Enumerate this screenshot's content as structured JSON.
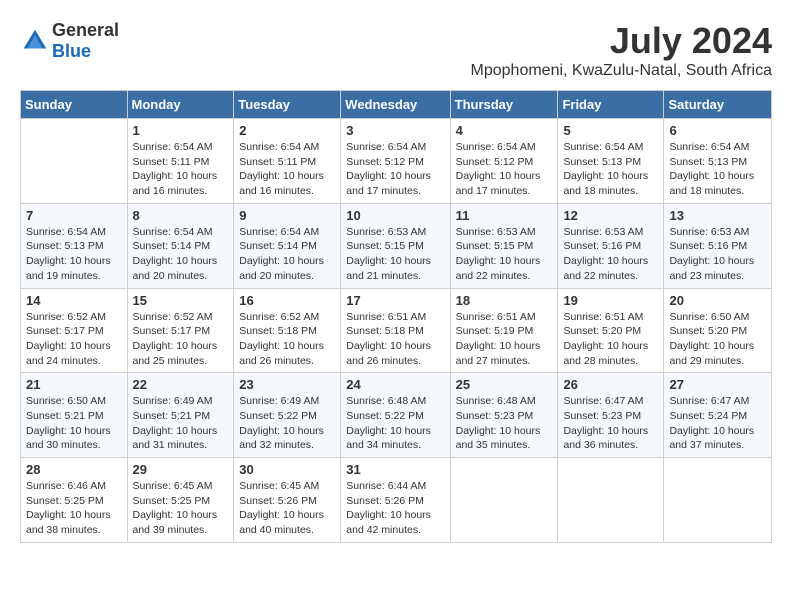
{
  "header": {
    "logo_general": "General",
    "logo_blue": "Blue",
    "month": "July 2024",
    "location": "Mpophomeni, KwaZulu-Natal, South Africa"
  },
  "weekdays": [
    "Sunday",
    "Monday",
    "Tuesday",
    "Wednesday",
    "Thursday",
    "Friday",
    "Saturday"
  ],
  "weeks": [
    [
      {
        "day": "",
        "sunrise": "",
        "sunset": "",
        "daylight": ""
      },
      {
        "day": "1",
        "sunrise": "Sunrise: 6:54 AM",
        "sunset": "Sunset: 5:11 PM",
        "daylight": "Daylight: 10 hours and 16 minutes."
      },
      {
        "day": "2",
        "sunrise": "Sunrise: 6:54 AM",
        "sunset": "Sunset: 5:11 PM",
        "daylight": "Daylight: 10 hours and 16 minutes."
      },
      {
        "day": "3",
        "sunrise": "Sunrise: 6:54 AM",
        "sunset": "Sunset: 5:12 PM",
        "daylight": "Daylight: 10 hours and 17 minutes."
      },
      {
        "day": "4",
        "sunrise": "Sunrise: 6:54 AM",
        "sunset": "Sunset: 5:12 PM",
        "daylight": "Daylight: 10 hours and 17 minutes."
      },
      {
        "day": "5",
        "sunrise": "Sunrise: 6:54 AM",
        "sunset": "Sunset: 5:13 PM",
        "daylight": "Daylight: 10 hours and 18 minutes."
      },
      {
        "day": "6",
        "sunrise": "Sunrise: 6:54 AM",
        "sunset": "Sunset: 5:13 PM",
        "daylight": "Daylight: 10 hours and 18 minutes."
      }
    ],
    [
      {
        "day": "7",
        "sunrise": "Sunrise: 6:54 AM",
        "sunset": "Sunset: 5:13 PM",
        "daylight": "Daylight: 10 hours and 19 minutes."
      },
      {
        "day": "8",
        "sunrise": "Sunrise: 6:54 AM",
        "sunset": "Sunset: 5:14 PM",
        "daylight": "Daylight: 10 hours and 20 minutes."
      },
      {
        "day": "9",
        "sunrise": "Sunrise: 6:54 AM",
        "sunset": "Sunset: 5:14 PM",
        "daylight": "Daylight: 10 hours and 20 minutes."
      },
      {
        "day": "10",
        "sunrise": "Sunrise: 6:53 AM",
        "sunset": "Sunset: 5:15 PM",
        "daylight": "Daylight: 10 hours and 21 minutes."
      },
      {
        "day": "11",
        "sunrise": "Sunrise: 6:53 AM",
        "sunset": "Sunset: 5:15 PM",
        "daylight": "Daylight: 10 hours and 22 minutes."
      },
      {
        "day": "12",
        "sunrise": "Sunrise: 6:53 AM",
        "sunset": "Sunset: 5:16 PM",
        "daylight": "Daylight: 10 hours and 22 minutes."
      },
      {
        "day": "13",
        "sunrise": "Sunrise: 6:53 AM",
        "sunset": "Sunset: 5:16 PM",
        "daylight": "Daylight: 10 hours and 23 minutes."
      }
    ],
    [
      {
        "day": "14",
        "sunrise": "Sunrise: 6:52 AM",
        "sunset": "Sunset: 5:17 PM",
        "daylight": "Daylight: 10 hours and 24 minutes."
      },
      {
        "day": "15",
        "sunrise": "Sunrise: 6:52 AM",
        "sunset": "Sunset: 5:17 PM",
        "daylight": "Daylight: 10 hours and 25 minutes."
      },
      {
        "day": "16",
        "sunrise": "Sunrise: 6:52 AM",
        "sunset": "Sunset: 5:18 PM",
        "daylight": "Daylight: 10 hours and 26 minutes."
      },
      {
        "day": "17",
        "sunrise": "Sunrise: 6:51 AM",
        "sunset": "Sunset: 5:18 PM",
        "daylight": "Daylight: 10 hours and 26 minutes."
      },
      {
        "day": "18",
        "sunrise": "Sunrise: 6:51 AM",
        "sunset": "Sunset: 5:19 PM",
        "daylight": "Daylight: 10 hours and 27 minutes."
      },
      {
        "day": "19",
        "sunrise": "Sunrise: 6:51 AM",
        "sunset": "Sunset: 5:20 PM",
        "daylight": "Daylight: 10 hours and 28 minutes."
      },
      {
        "day": "20",
        "sunrise": "Sunrise: 6:50 AM",
        "sunset": "Sunset: 5:20 PM",
        "daylight": "Daylight: 10 hours and 29 minutes."
      }
    ],
    [
      {
        "day": "21",
        "sunrise": "Sunrise: 6:50 AM",
        "sunset": "Sunset: 5:21 PM",
        "daylight": "Daylight: 10 hours and 30 minutes."
      },
      {
        "day": "22",
        "sunrise": "Sunrise: 6:49 AM",
        "sunset": "Sunset: 5:21 PM",
        "daylight": "Daylight: 10 hours and 31 minutes."
      },
      {
        "day": "23",
        "sunrise": "Sunrise: 6:49 AM",
        "sunset": "Sunset: 5:22 PM",
        "daylight": "Daylight: 10 hours and 32 minutes."
      },
      {
        "day": "24",
        "sunrise": "Sunrise: 6:48 AM",
        "sunset": "Sunset: 5:22 PM",
        "daylight": "Daylight: 10 hours and 34 minutes."
      },
      {
        "day": "25",
        "sunrise": "Sunrise: 6:48 AM",
        "sunset": "Sunset: 5:23 PM",
        "daylight": "Daylight: 10 hours and 35 minutes."
      },
      {
        "day": "26",
        "sunrise": "Sunrise: 6:47 AM",
        "sunset": "Sunset: 5:23 PM",
        "daylight": "Daylight: 10 hours and 36 minutes."
      },
      {
        "day": "27",
        "sunrise": "Sunrise: 6:47 AM",
        "sunset": "Sunset: 5:24 PM",
        "daylight": "Daylight: 10 hours and 37 minutes."
      }
    ],
    [
      {
        "day": "28",
        "sunrise": "Sunrise: 6:46 AM",
        "sunset": "Sunset: 5:25 PM",
        "daylight": "Daylight: 10 hours and 38 minutes."
      },
      {
        "day": "29",
        "sunrise": "Sunrise: 6:45 AM",
        "sunset": "Sunset: 5:25 PM",
        "daylight": "Daylight: 10 hours and 39 minutes."
      },
      {
        "day": "30",
        "sunrise": "Sunrise: 6:45 AM",
        "sunset": "Sunset: 5:26 PM",
        "daylight": "Daylight: 10 hours and 40 minutes."
      },
      {
        "day": "31",
        "sunrise": "Sunrise: 6:44 AM",
        "sunset": "Sunset: 5:26 PM",
        "daylight": "Daylight: 10 hours and 42 minutes."
      },
      {
        "day": "",
        "sunrise": "",
        "sunset": "",
        "daylight": ""
      },
      {
        "day": "",
        "sunrise": "",
        "sunset": "",
        "daylight": ""
      },
      {
        "day": "",
        "sunrise": "",
        "sunset": "",
        "daylight": ""
      }
    ]
  ]
}
